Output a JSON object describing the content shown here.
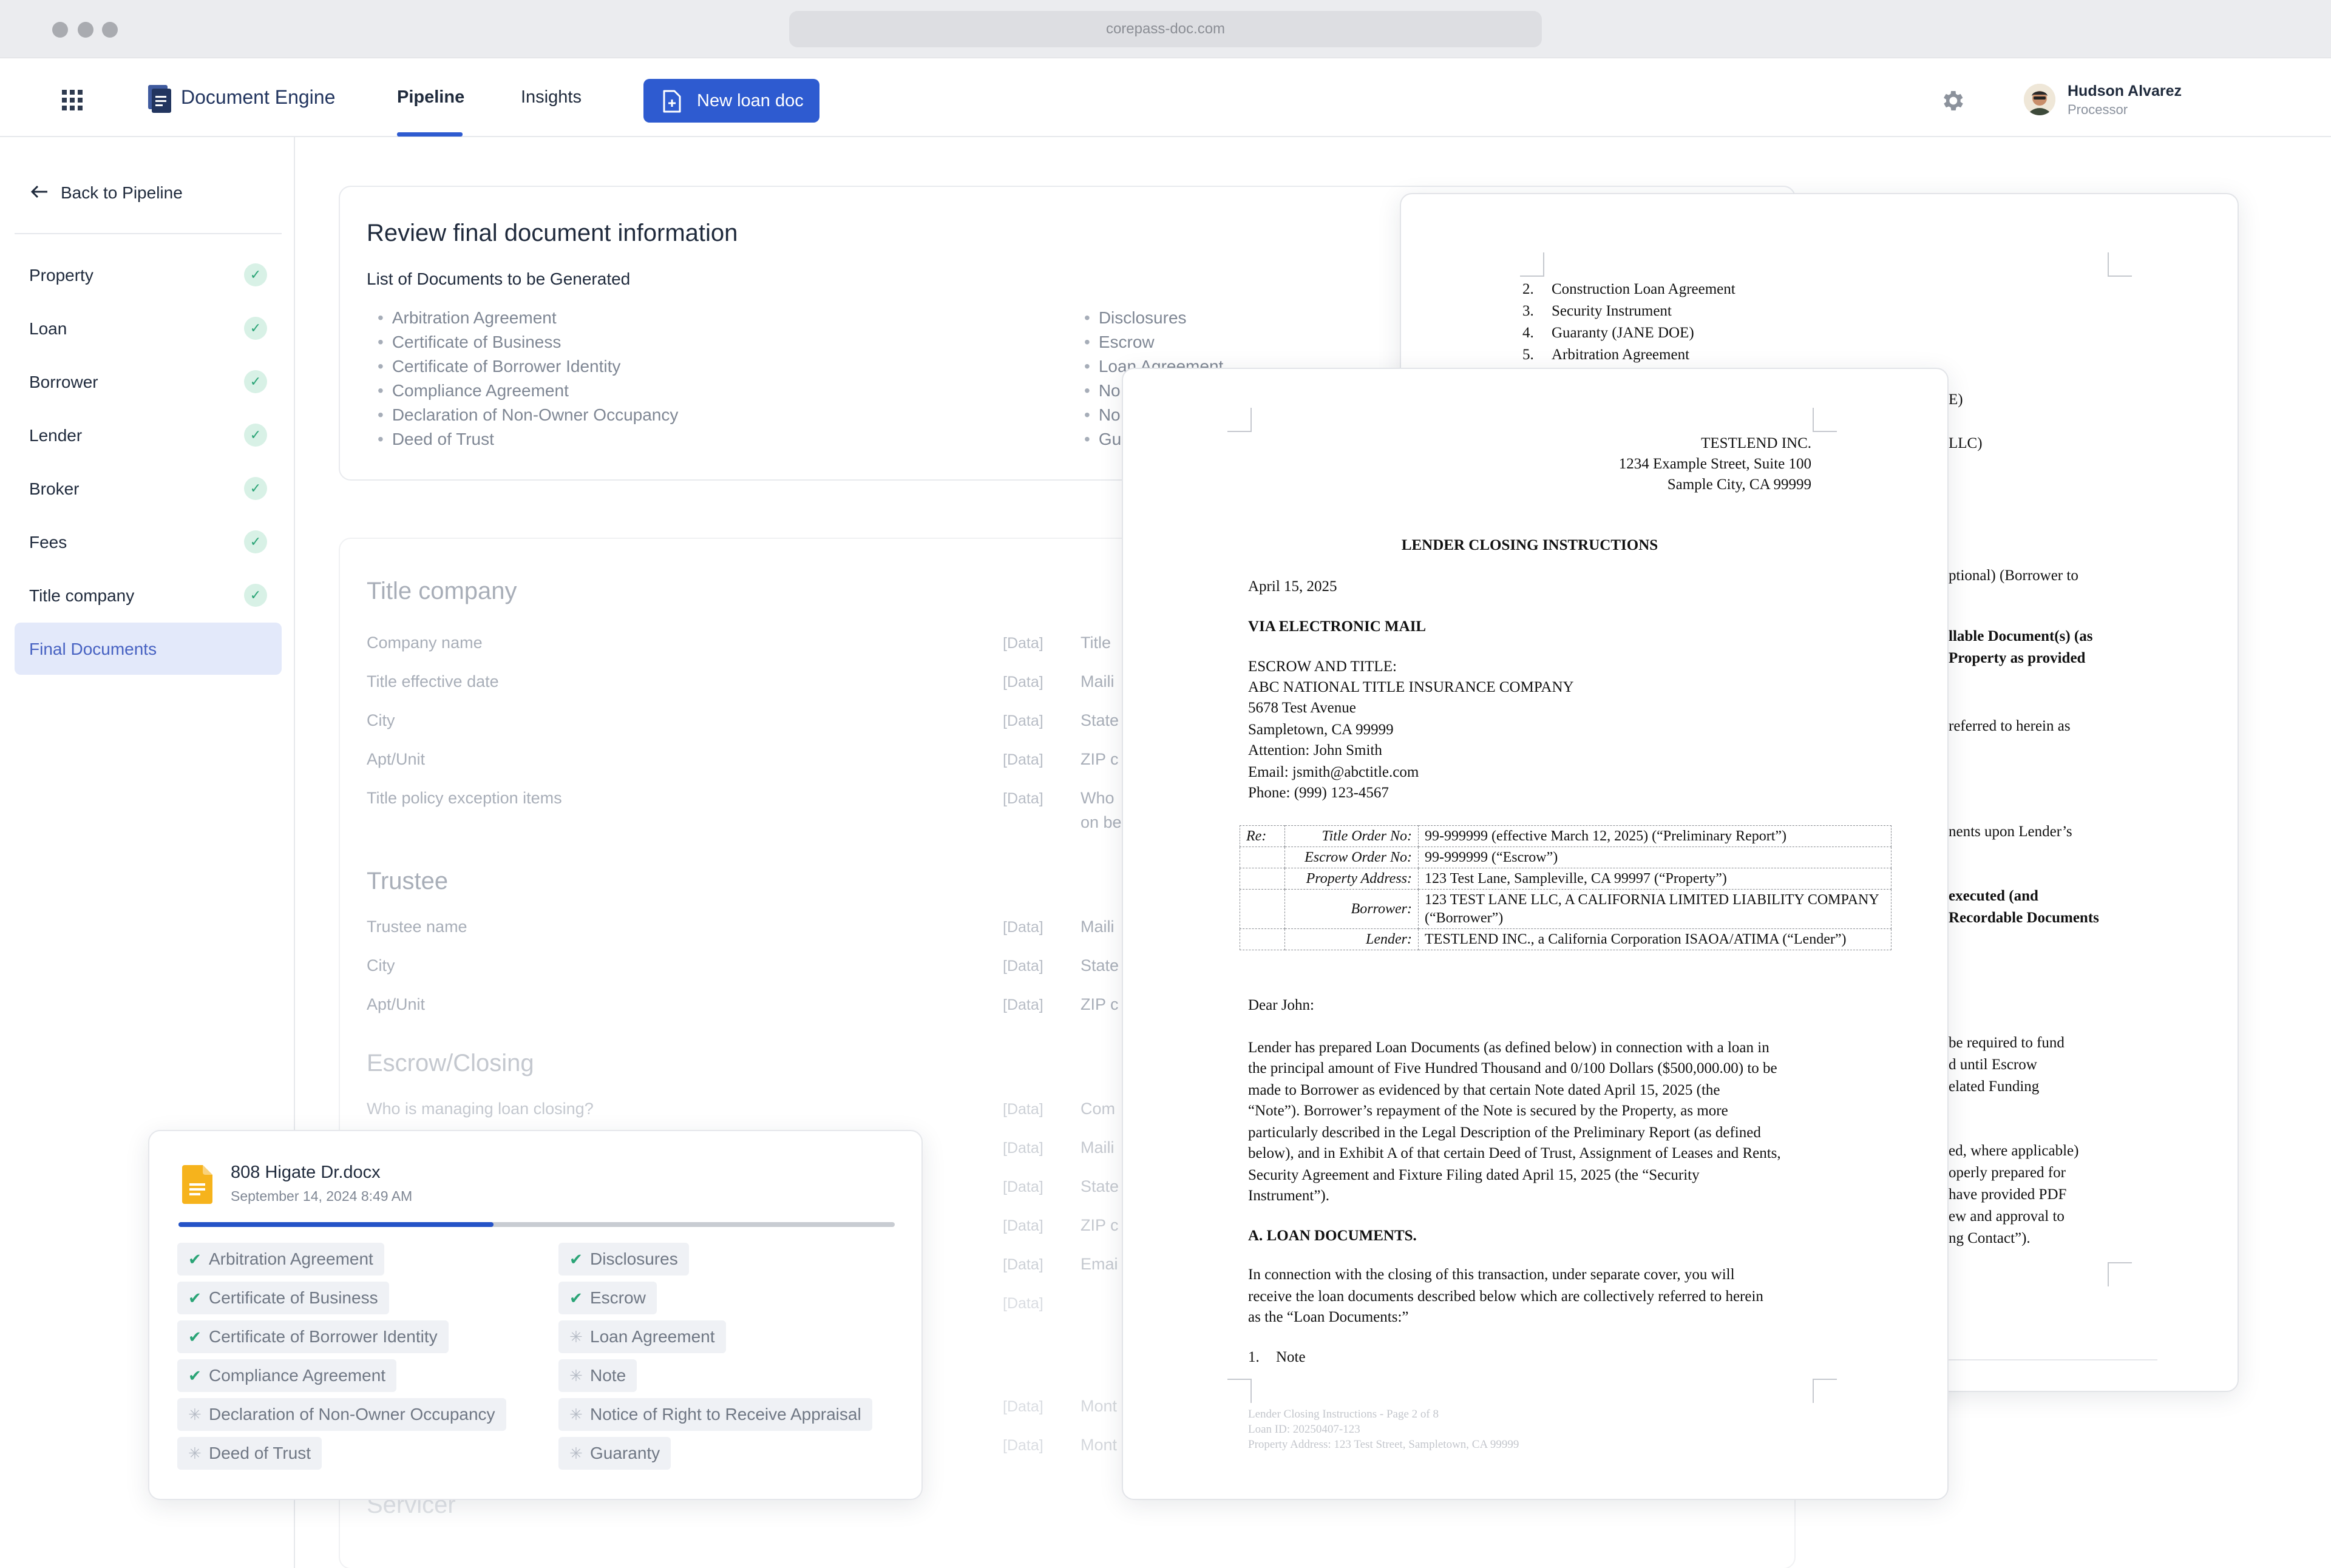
{
  "browser": {
    "url": "corepass-doc.com"
  },
  "topnav": {
    "brand": "Document Engine",
    "tabs": [
      {
        "label": "Pipeline",
        "active": true
      },
      {
        "label": "Insights",
        "active": false
      }
    ],
    "new_button": "New loan doc",
    "user": {
      "name": "Hudson Alvarez",
      "role": "Processor"
    },
    "accent": "#2e5bd0"
  },
  "sidebar": {
    "back": "Back to Pipeline",
    "items": [
      {
        "label": "Property",
        "done": true
      },
      {
        "label": "Loan",
        "done": true
      },
      {
        "label": "Borrower",
        "done": true
      },
      {
        "label": "Lender",
        "done": true
      },
      {
        "label": "Broker",
        "done": true
      },
      {
        "label": "Fees",
        "done": true
      },
      {
        "label": "Title company",
        "done": true
      },
      {
        "label": "Final Documents",
        "active": true
      }
    ]
  },
  "review": {
    "title": "Review final document information",
    "subtitle": "List of Documents to be Generated",
    "left_docs": [
      "Arbitration Agreement",
      "Certificate of Business",
      "Certificate of Borrower Identity",
      "Compliance Agreement",
      "Declaration of Non-Owner Occupancy",
      "Deed of Trust"
    ],
    "right_docs": [
      "Disclosures",
      "Escrow",
      "Loan Agreement",
      "No",
      "No",
      "Gu"
    ]
  },
  "form": {
    "placeholder": "[Data]",
    "sections": [
      {
        "title": "Title company",
        "fields": [
          "Company name",
          "Title effective date",
          "City",
          "Apt/Unit",
          "Title policy exception items"
        ],
        "right": [
          "Title",
          "Maili",
          "State",
          "ZIP c",
          "Who",
          "on be"
        ]
      },
      {
        "title": "Trustee",
        "fields": [
          "Trustee name",
          "City",
          "Apt/Unit"
        ],
        "right": [
          "Maili",
          "State",
          "ZIP c"
        ]
      },
      {
        "title": "Escrow/Closing",
        "fields": [
          "Who is managing loan closing?"
        ],
        "right": [
          "Com",
          "Maili",
          "State",
          "ZIP c",
          "Emai",
          "Mont",
          "Mont"
        ]
      },
      {
        "title": "Servicer"
      }
    ]
  },
  "back_doc": {
    "list": [
      {
        "n": "2.",
        "t": "Construction Loan Agreement"
      },
      {
        "n": "3.",
        "t": "Security Instrument"
      },
      {
        "n": "4.",
        "t": "Guaranty (JANE DOE)"
      },
      {
        "n": "5.",
        "t": "Arbitration Agreement"
      }
    ],
    "fragments": [
      "E)",
      "LLC)",
      "ptional) (Borrower to",
      "llable Document(s) (as",
      "Property as provided",
      "referred to herein as",
      "nents upon Lender’s",
      "executed (and",
      "Recordable Documents",
      "be required to fund",
      "d until Escrow",
      "elated Funding",
      "ed, where applicable)",
      "operly prepared for",
      "have provided PDF",
      "ew and approval to",
      "ng Contact”)."
    ]
  },
  "front_doc": {
    "lender_block": [
      "TESTLEND INC.",
      "1234 Example Street, Suite 100",
      "Sample City, CA 99999"
    ],
    "heading": "LENDER CLOSING INSTRUCTIONS",
    "date": "April 15, 2025",
    "via": "VIA ELECTRONIC MAIL",
    "escrow": [
      "ESCROW AND TITLE:",
      "ABC NATIONAL TITLE INSURANCE COMPANY",
      "5678 Test Avenue",
      "Sampletown, CA 99999",
      "Attention: John Smith",
      "Email: jsmith@abctitle.com",
      "Phone: (999) 123-4567"
    ],
    "re_label": "Re:",
    "re_rows": [
      {
        "k": "Title Order No:",
        "v": "99-999999 (effective March 12, 2025) (“Preliminary Report”)"
      },
      {
        "k": "Escrow Order No:",
        "v": "99-999999 (“Escrow”)"
      },
      {
        "k": "Property Address:",
        "v": "123 Test Lane, Sampleville, CA 99997 (“Property”)"
      },
      {
        "k": "Borrower:",
        "v": "123 TEST LANE LLC, A CALIFORNIA LIMITED LIABILITY COMPANY (“Borrower”)"
      },
      {
        "k": "Lender:",
        "v": "TESTLEND INC., a California Corporation ISAOA/ATIMA (“Lender”)"
      }
    ],
    "salutation": "Dear John:",
    "para_lines": [
      "Lender has prepared Loan Documents (as defined below) in connection with a loan in",
      "the principal amount of Five Hundred Thousand and 0/100 Dollars ($500,000.00) to be",
      "made to Borrower as evidenced by that certain Note dated April 15, 2025 (the",
      "“Note”). Borrower’s repayment of the Note is secured by the Property, as more",
      "particularly described in the Legal Description of the Preliminary Report (as defined",
      "below), and in Exhibit A of that certain Deed of Trust, Assignment of Leases and Rents,",
      "Security Agreement and Fixture Filing dated April 15, 2025 (the “Security",
      "Instrument”)."
    ],
    "section_a": "A. LOAN DOCUMENTS.",
    "para2_lines": [
      "In connection with the closing of this transaction, under separate cover, you will",
      "receive the loan documents described below which are collectively referred to herein",
      "as the “Loan Documents:”"
    ],
    "item1": {
      "n": "1.",
      "t": "Note"
    },
    "footer": [
      "Lender Closing Instructions - Page 2 of 8",
      "Loan ID: 20250407-123",
      "Property Address: 123 Test Street, Sampletown, CA 99999"
    ]
  },
  "upload": {
    "file": "808 Higate Dr.docx",
    "date": "September 14, 2024 8:49 AM",
    "progress": 0.44,
    "left": [
      {
        "label": "Arbitration Agreement",
        "done": true
      },
      {
        "label": "Certificate of Business",
        "done": true
      },
      {
        "label": "Certificate of Borrower Identity",
        "done": true
      },
      {
        "label": "Compliance Agreement",
        "done": true
      },
      {
        "label": "Declaration of Non-Owner Occupancy",
        "done": false
      },
      {
        "label": "Deed of Trust",
        "done": false
      }
    ],
    "right": [
      {
        "label": "Disclosures",
        "done": true
      },
      {
        "label": "Escrow",
        "done": true
      },
      {
        "label": "Loan Agreement",
        "done": false
      },
      {
        "label": "Note",
        "done": false
      },
      {
        "label": "Notice of Right to Receive Appraisal",
        "done": false
      },
      {
        "label": "Guaranty",
        "done": false
      }
    ]
  }
}
